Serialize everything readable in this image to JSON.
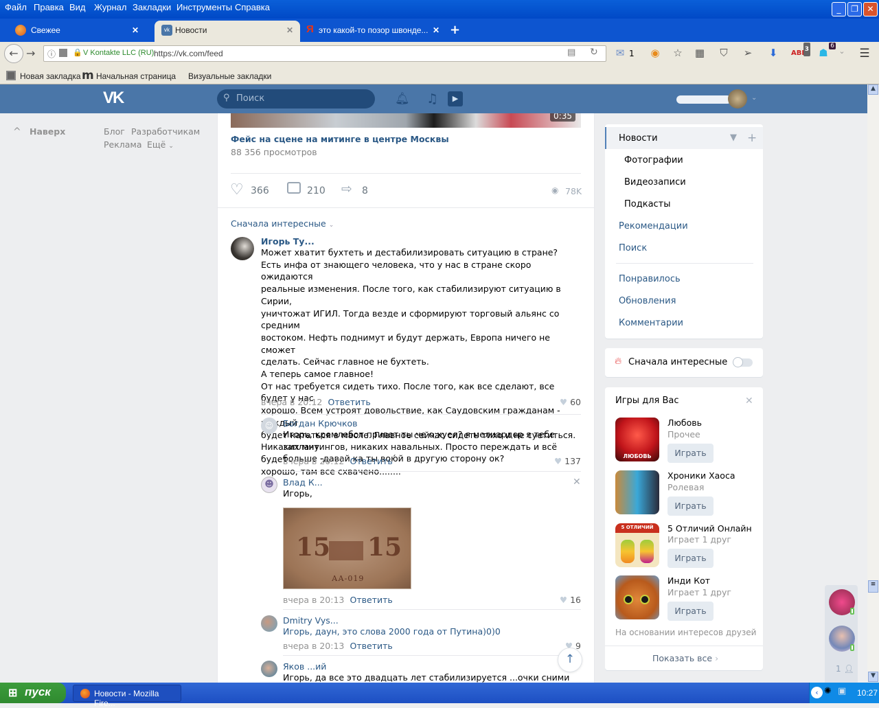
{
  "browser": {
    "menu": [
      "Файл",
      "Правка",
      "Вид",
      "Журнал",
      "Закладки",
      "Инструменты",
      "Справка"
    ],
    "tabs": [
      {
        "title": "Свежее",
        "active": false
      },
      {
        "title": "Новости",
        "active": true
      },
      {
        "title": "это какой-то позор швонде...",
        "active": false
      }
    ],
    "new_tab": "+",
    "site_identity": "V Kontakte LLC (RU)",
    "url": "https://vk.com/feed",
    "mail_count": "1",
    "abp_badge": "3",
    "ghost_badge": "6",
    "bookmarks": [
      "Новая закладка",
      "Начальная страница",
      "Визуальные закладки"
    ]
  },
  "vk_header": {
    "logo": "VK",
    "search_placeholder": "Поиск",
    "user_name": "(скрыто)"
  },
  "left_col": {
    "to_top": "Наверх",
    "links": [
      "Блог",
      "Разработчикам",
      "Реклама",
      "Ещё"
    ]
  },
  "post": {
    "video_duration": "0:35",
    "video_title": "Фейс на сцене на митинге в центре Москвы",
    "video_views": "88 356 просмотров",
    "likes": "366",
    "comments": "210",
    "shares": "8",
    "views": "78K",
    "sort_label": "Сначала интересные"
  },
  "comments": [
    {
      "author": "Игорь Ту...",
      "lines": [
        "Может хватит бухтеть и дестабилизировать ситуацию в стране?",
        "Есть инфа от знающего человека, что у нас в стране скоро ожидаются",
        "реальные изменения. После того, как стабилизируют ситуацию в Сирии,",
        "уничтожат ИГИЛ. Тогда везде и сформируют торговый альянс со средним",
        "востоком. Нефть поднимут и будут держать, Европа ничего не сможет",
        "сделать. Сейчас главное не бухтеть.",
        "А теперь самое главное!",
        "От нас требуется сидеть тихо. После того, как все сделают, все будет у нас",
        "хорошо. Всем устроят довольствие, как Саудовским гражданам - каждый",
        "будет кататься в масле. Главное сейчас сидеть тихо и не суетиться.",
        "Никаких митингов, никаких навальных. Просто переждать и всё будет",
        "хорошо, там все схвачено........"
      ],
      "time": "вчера в 20:12",
      "reply": "Ответить",
      "likes": "60"
    },
    {
      "author": "Богдан Крючков",
      "lines": [
        "Игорь, кремлебот привет ты че о;хуел? я мелиардер я тебе заплачу",
        "больше -давай ка ты вою́й в другую сторону ок?"
      ],
      "time": "вчера в 20:12",
      "reply": "Ответить",
      "likes": "137"
    },
    {
      "author": "Влад К...",
      "lines": [
        "Игорь,"
      ],
      "image_caption": "15 рублей — расчетный знак РСФСР, АА-019",
      "time": "вчера в 20:13",
      "reply": "Ответить",
      "likes": "16"
    },
    {
      "author": "Dmitry Vys...",
      "lines": [
        "Игорь, даун, это слова 2000 года от Путина)0)0"
      ],
      "time": "вчера в 20:13",
      "reply": "Ответить",
      "likes": "9"
    },
    {
      "author": "Яков ...ий",
      "lines": [
        "Игорь, да все это двадцать лет стабилизируется ...очки сними"
      ]
    }
  ],
  "right_menu": {
    "items": [
      "Новости",
      "Фотографии",
      "Видеозаписи",
      "Подкасты",
      "Рекомендации",
      "Поиск",
      "Понравилось",
      "Обновления",
      "Комментарии"
    ],
    "interesting_first": "Сначала интересные",
    "toggle_on": false
  },
  "games": {
    "title": "Игры для Вас",
    "items": [
      {
        "name": "Любовь",
        "sub": "Прочее",
        "button": "Играть",
        "icon_text": "ЛЮБОВЬ"
      },
      {
        "name": "Хроники Хаоса",
        "sub": "Ролевая",
        "button": "Играть"
      },
      {
        "name": "5 Отличий Онлайн",
        "sub": "Играет 1 друг",
        "button": "Играть",
        "icon_text": "5 ОТЛИЧИЙ"
      },
      {
        "name": "Инди Кот",
        "sub": "Играет 1 друг",
        "button": "Играть"
      }
    ],
    "footer_note": "На основании интересов друзей",
    "show_all": "Показать все"
  },
  "friends_online": {
    "extra_count": "1"
  },
  "taskbar": {
    "start": "пуск",
    "task": "Новости - Mozilla Fire...",
    "clock": "10:27"
  },
  "colors": {
    "vk_blue": "#4a76a8",
    "link": "#2a5885",
    "xp_blue": "#0d55d0"
  }
}
